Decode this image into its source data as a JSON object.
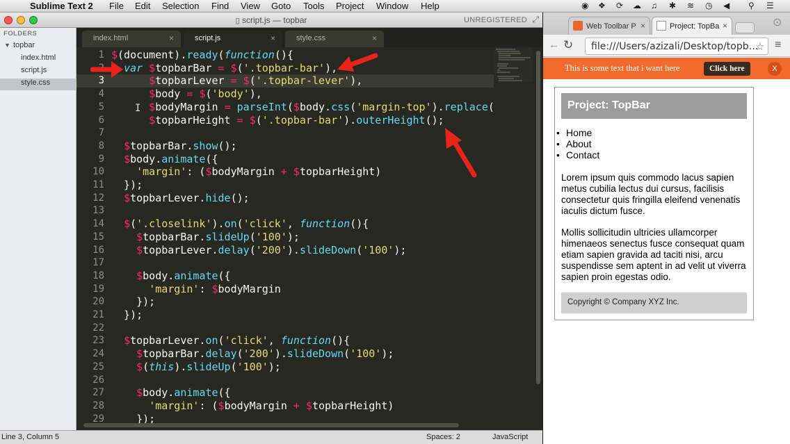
{
  "menubar": {
    "app": "Sublime Text 2",
    "items": [
      "File",
      "Edit",
      "Selection",
      "Find",
      "View",
      "Goto",
      "Tools",
      "Project",
      "Window",
      "Help"
    ]
  },
  "sublime": {
    "window_title": "script.js — topbar",
    "unregistered": "UNREGISTERED",
    "sidebar": {
      "header": "FOLDERS",
      "folder": "topbar",
      "files": [
        "index.html",
        "script.js",
        "style.css"
      ]
    },
    "tabs": [
      {
        "label": "index.html",
        "close": "×"
      },
      {
        "label": "script.js",
        "close": "×"
      },
      {
        "label": "style.css",
        "close": "×"
      }
    ],
    "code_lines": [
      "$(document).ready(function(){",
      "  var $topbarBar = $('.topbar-bar'),",
      "      $topbarLever = $('.topbar-lever'),",
      "      $body = $('body'),",
      "      $bodyMargin = parseInt($body.css('margin-top').replace(",
      "      $topbarHeight = $('.topbar-bar').outerHeight();",
      "",
      "  $topbarBar.show();",
      "  $body.animate({",
      "    'margin': ($bodyMargin + $topbarHeight)",
      "  });",
      "  $topbarLever.hide();",
      "",
      "  $('.closelink').on('click', function(){",
      "    $topbarBar.slideUp('100');",
      "    $topbarLever.delay('200').slideDown('100');",
      "",
      "    $body.animate({",
      "      'margin': $bodyMargin",
      "    });",
      "  });",
      "",
      "  $topbarLever.on('click', function(){",
      "    $topbarBar.delay('200').slideDown('100');",
      "    $(this).slideUp('100');",
      "",
      "    $body.animate({",
      "      'margin': ($bodyMargin + $topbarHeight)",
      "    });"
    ],
    "line_numbers": [
      "1",
      "2",
      "3",
      "4",
      "5",
      "6",
      "7",
      "8",
      "9",
      "10",
      "11",
      "12",
      "13",
      "14",
      "15",
      "16",
      "17",
      "18",
      "19",
      "20",
      "21",
      "22",
      "23",
      "24",
      "25",
      "26",
      "27",
      "28",
      "29"
    ],
    "current_line": 3,
    "status": {
      "position": "Line 3, Column 5",
      "spaces": "Spaces: 2",
      "syntax": "JavaScript"
    }
  },
  "chrome": {
    "tabs": [
      {
        "label": "Web Toolbar P",
        "close": "×"
      },
      {
        "label": "Project: TopBa",
        "close": "×"
      }
    ],
    "address": "file:///Users/azizali/Desktop/topb…",
    "topbar": {
      "text": "This is some text that i want here",
      "button": "Click here",
      "close": "X"
    },
    "page": {
      "title": "Project: TopBar",
      "nav": [
        "Home",
        "About",
        "Contact"
      ],
      "paragraphs": [
        "Lorem ipsum quis commodo lacus sapien metus cubilia lectus dui cursus, facilisis consectetur quis fringilla eleifend venenatis iaculis dictum fusce.",
        "Mollis sollicitudin ultricies ullamcorper himenaeos senectus fusce consequat quam etiam sapien gravida ad taciti nisi, arcu suspendisse sem aptent in ad velit ut viverra sapien proin egestas odio."
      ],
      "footer": "Copyright © Company XYZ Inc."
    }
  },
  "colors": {
    "editor_bg": "#272822",
    "keyword": "#66d9ef",
    "string": "#e6db74",
    "operator": "#f92672",
    "topbar_orange": "#f26b2d",
    "annotation_arrow": "#e8231c"
  }
}
